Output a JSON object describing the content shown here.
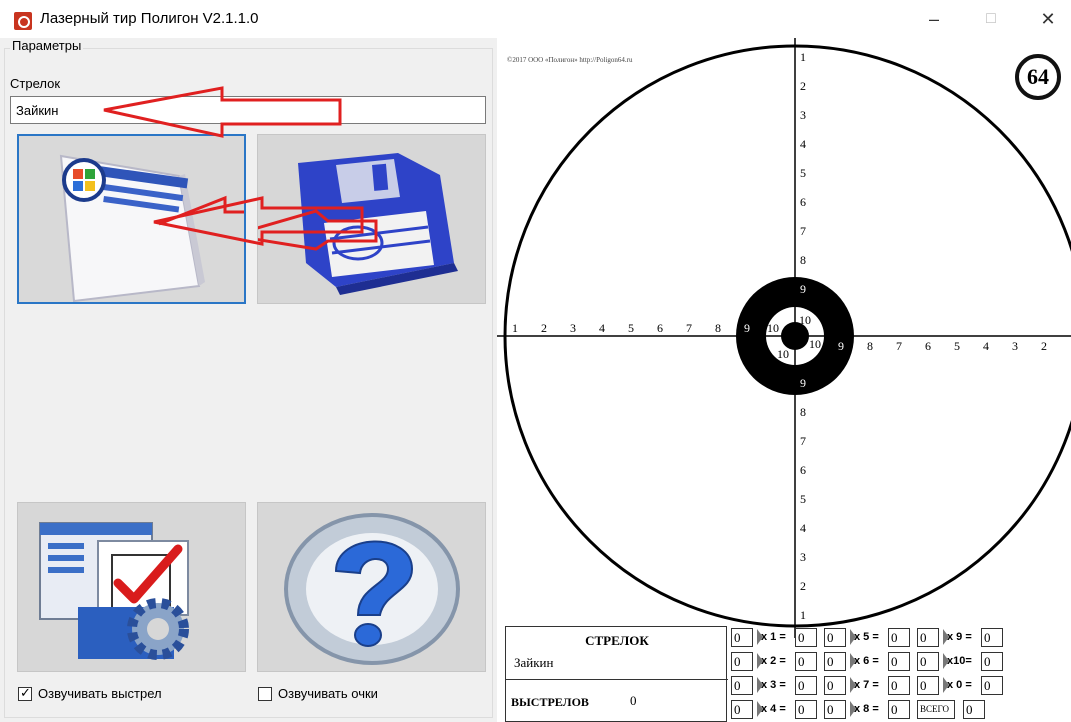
{
  "window": {
    "title": "Лазерный тир Полигон V2.1.1.0",
    "minimize": "–",
    "maximize": "□",
    "close": "✕"
  },
  "params": {
    "group_title": "Параметры",
    "shooter_label": "Стрелок",
    "shooter_value": "Зайкин",
    "sound_shot_label": "Озвучивать выстрел",
    "sound_shot_checked": true,
    "sound_points_label": "Озвучивать очки",
    "sound_points_checked": false
  },
  "target": {
    "copyright": "©2017 ООО «Полигон» http://Poligon64.ru",
    "logo_text": "64",
    "rings": [
      "1",
      "2",
      "3",
      "4",
      "5",
      "6",
      "7",
      "8",
      "9",
      "10"
    ],
    "colors": {
      "ink": "#000000",
      "paper": "#ffffff"
    }
  },
  "scores": {
    "shooter_header": "СТРЕЛОК",
    "shooter_name": "Зайкин",
    "shots_label": "ВЫСТРЕЛОВ",
    "shots_value": "0",
    "rows": [
      [
        {
          "count": "0",
          "label": "x 1 =",
          "value": "0"
        },
        {
          "count": "0",
          "label": "x 5 =",
          "value": "0"
        },
        {
          "count": "0",
          "label": "x 9 =",
          "value": "0"
        }
      ],
      [
        {
          "count": "0",
          "label": "x 2 =",
          "value": "0"
        },
        {
          "count": "0",
          "label": "x 6 =",
          "value": "0"
        },
        {
          "count": "0",
          "label": "x10=",
          "value": "0"
        }
      ],
      [
        {
          "count": "0",
          "label": "x 3 =",
          "value": "0"
        },
        {
          "count": "0",
          "label": "x 7 =",
          "value": "0"
        },
        {
          "count": "0",
          "label": "x 0 =",
          "value": "0"
        }
      ],
      [
        {
          "count": "0",
          "label": "x 4 =",
          "value": "0"
        },
        {
          "count": "0",
          "label": "x 8 =",
          "value": "0"
        },
        {
          "count": "ВСЕГО",
          "label": "",
          "value": "0"
        }
      ]
    ]
  },
  "colors": {
    "accent_selection": "#2a76c6",
    "annotation_arrow": "#e02020"
  }
}
